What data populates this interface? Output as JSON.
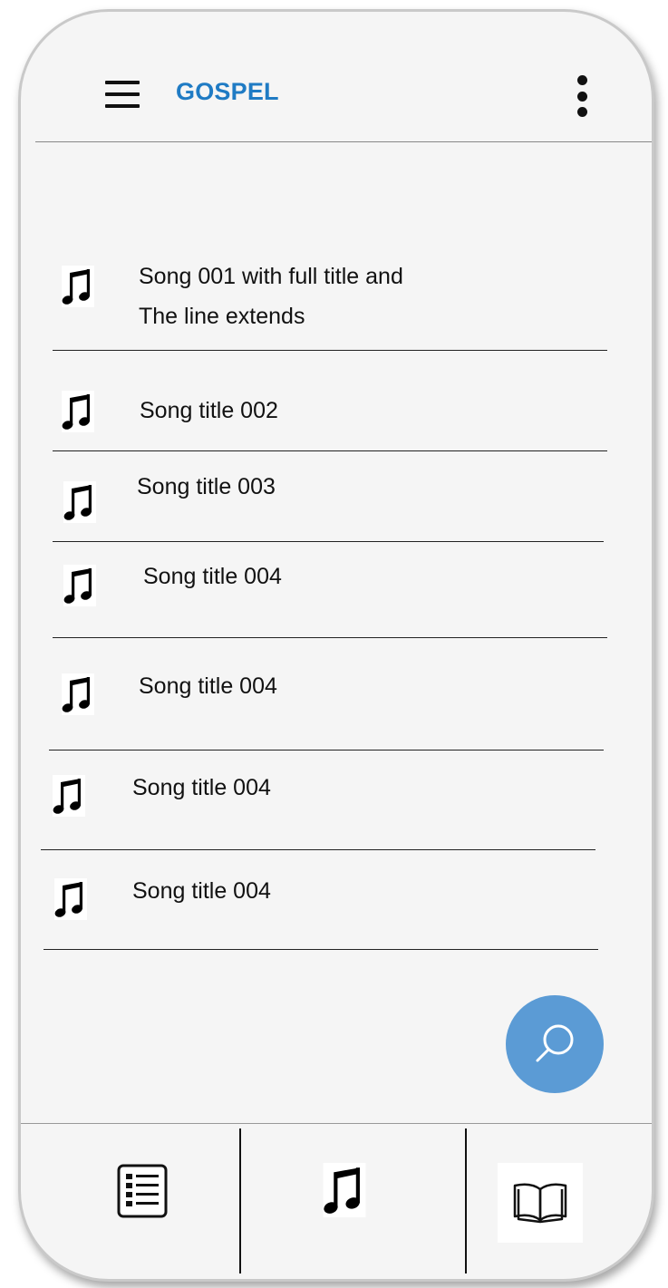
{
  "app_bar": {
    "title": "GOSPEL",
    "menu_icon": "hamburger-menu-icon",
    "more_icon": "more-vertical-icon"
  },
  "songs": [
    {
      "line1": "Song 001 with full title and",
      "line2": "The line extends"
    },
    {
      "line1": "Song title 002"
    },
    {
      "line1": "Song title 003"
    },
    {
      "line1": "Song title 004"
    },
    {
      "line1": "Song title 004"
    },
    {
      "line1": "Song title 004"
    },
    {
      "line1": "Song title 004"
    }
  ],
  "fab": {
    "icon": "search-icon",
    "color": "#5b9bd5"
  },
  "bottom_nav": [
    {
      "icon": "list-icon"
    },
    {
      "icon": "music-note-icon"
    },
    {
      "icon": "book-icon"
    }
  ],
  "colors": {
    "title": "#1f7bc4",
    "background": "#f5f5f5",
    "accent": "#5b9bd5"
  }
}
